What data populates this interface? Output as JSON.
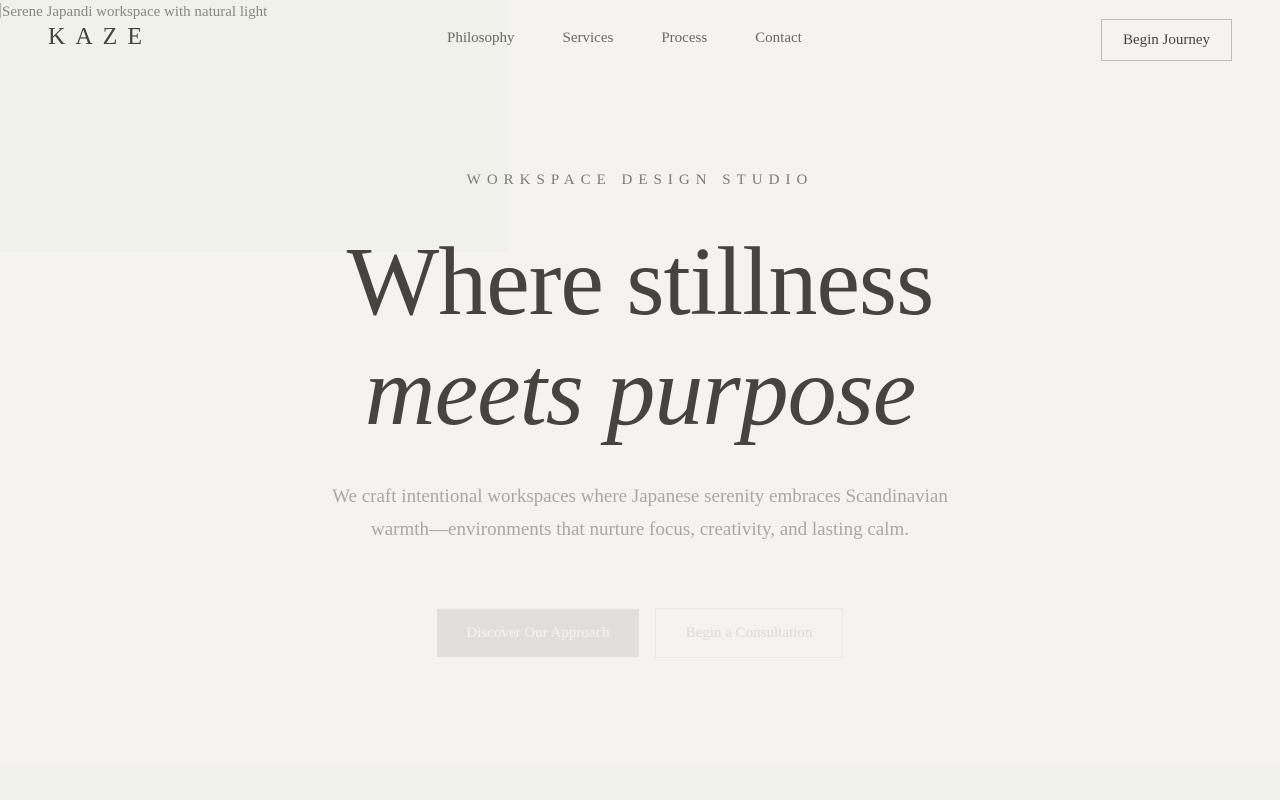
{
  "hero_image": {
    "alt": "Serene Japandi workspace with natural light"
  },
  "header": {
    "logo": "KAZE",
    "nav": [
      "Philosophy",
      "Services",
      "Process",
      "Contact"
    ],
    "cta": "Begin Journey"
  },
  "hero": {
    "eyebrow": "WORKSPACE DESIGN STUDIO",
    "headline_line1": "Where stillness",
    "headline_line2": "meets purpose",
    "subtitle": "We craft intentional workspaces where Japanese serenity embraces Scandinavian warmth—environments that nurture focus, creativity, and lasting calm.",
    "primary_button": "Discover Our Approach",
    "secondary_button": "Begin a Consultation"
  },
  "colors": {
    "background": "#f4f3ef",
    "text": "#45443f",
    "muted": "#a9a8a2"
  }
}
